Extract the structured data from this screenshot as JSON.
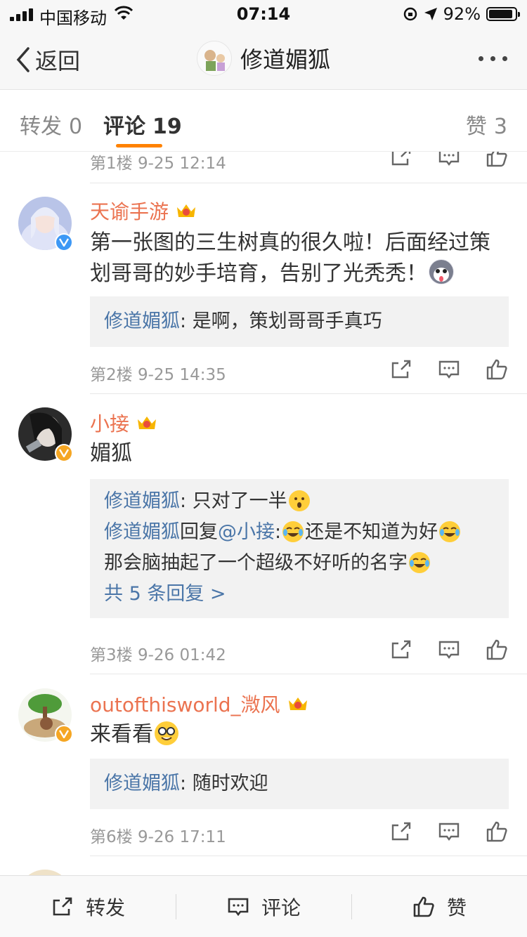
{
  "status": {
    "carrier": "中国移动",
    "time": "07:14",
    "battery": "92%",
    "battery_level": 0.92
  },
  "nav": {
    "back_label": "返回",
    "title": "修道媚狐"
  },
  "tabs": [
    {
      "label": "转发",
      "count": "0"
    },
    {
      "label": "评论",
      "count": "19"
    },
    {
      "label": "赞",
      "count": "3"
    }
  ],
  "comments": [
    {
      "floor_time": "第1楼 9-25 12:14"
    },
    {
      "user": "天谕手游",
      "text": "第一张图的三生树真的很久啦！后面经过策划哥哥的妙手培育，告别了光秃秃！",
      "replies": [
        {
          "who": "修道媚狐",
          "sep": ": ",
          "text": "是啊，策划哥哥手真巧"
        }
      ],
      "floor_time": "第2楼 9-25 14:35"
    },
    {
      "user": "小接",
      "text": "媚狐",
      "replies": [
        {
          "who": "修道媚狐",
          "sep": ": ",
          "text": "只对了一半"
        },
        {
          "who": "修道媚狐",
          "mid": "回复",
          "at": "@小接",
          "sep": ":",
          "text1": "还是不知道为好",
          "text2": "那会脑抽起了一个超级不好听的名字"
        }
      ],
      "more_replies": "共 5 条回复 >",
      "floor_time": "第3楼 9-26 01:42"
    },
    {
      "user": "outofthisworld_溦风",
      "text": "来看看",
      "replies": [
        {
          "who": "修道媚狐",
          "sep": ": ",
          "text": "随时欢迎"
        }
      ],
      "floor_time": "第6楼 9-26 17:11"
    }
  ],
  "bottom": {
    "repost": "转发",
    "comment": "评论",
    "like": "赞"
  },
  "colors": {
    "accent": "#ff8200",
    "username": "#eb7350",
    "link": "#4b76a8"
  }
}
